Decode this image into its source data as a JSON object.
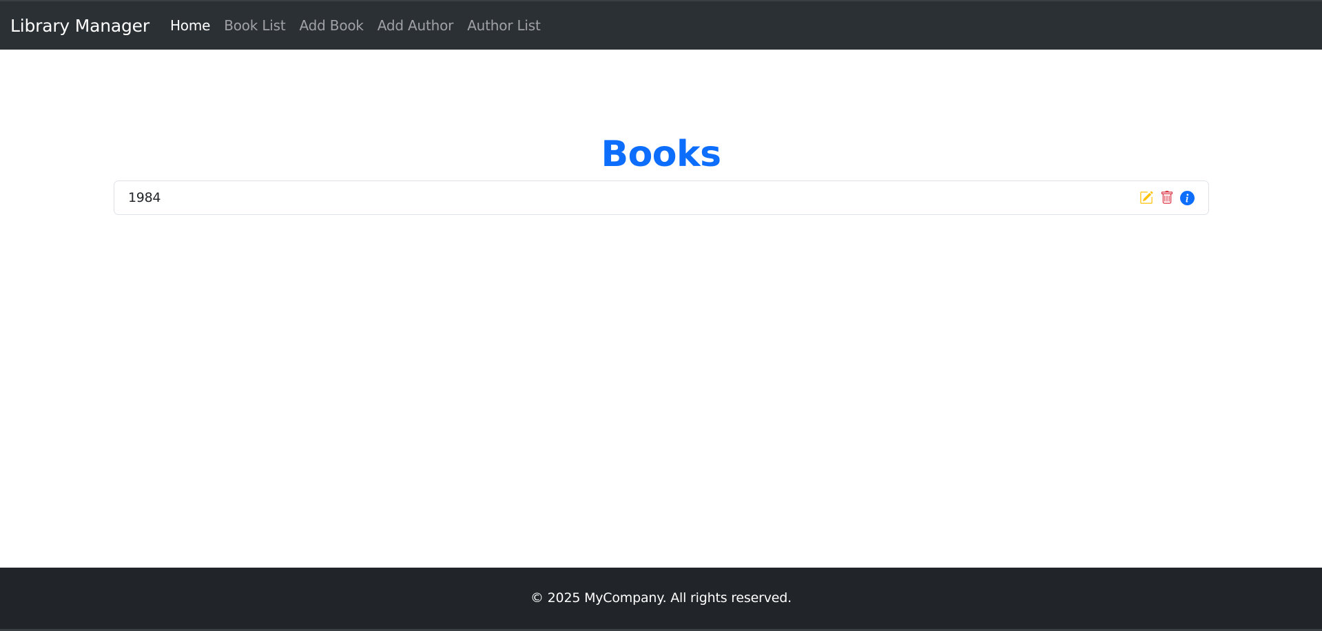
{
  "navbar": {
    "brand": "Library Manager",
    "links": [
      {
        "label": "Home"
      },
      {
        "label": "Book List"
      },
      {
        "label": "Add Book"
      },
      {
        "label": "Add Author"
      },
      {
        "label": "Author List"
      }
    ]
  },
  "main": {
    "title": "Books",
    "books": [
      {
        "title": "1984"
      }
    ]
  },
  "icons": {
    "edit": "edit-icon",
    "delete": "trash-icon",
    "info": "info-icon"
  },
  "colors": {
    "navbar_bg": "#2b3035",
    "title": "#0d6efd",
    "edit": "#ffc107",
    "delete": "#dc3545",
    "info": "#0d6efd",
    "footer_bg": "#212529"
  },
  "footer": {
    "text": "© 2025 MyCompany. All rights reserved."
  }
}
